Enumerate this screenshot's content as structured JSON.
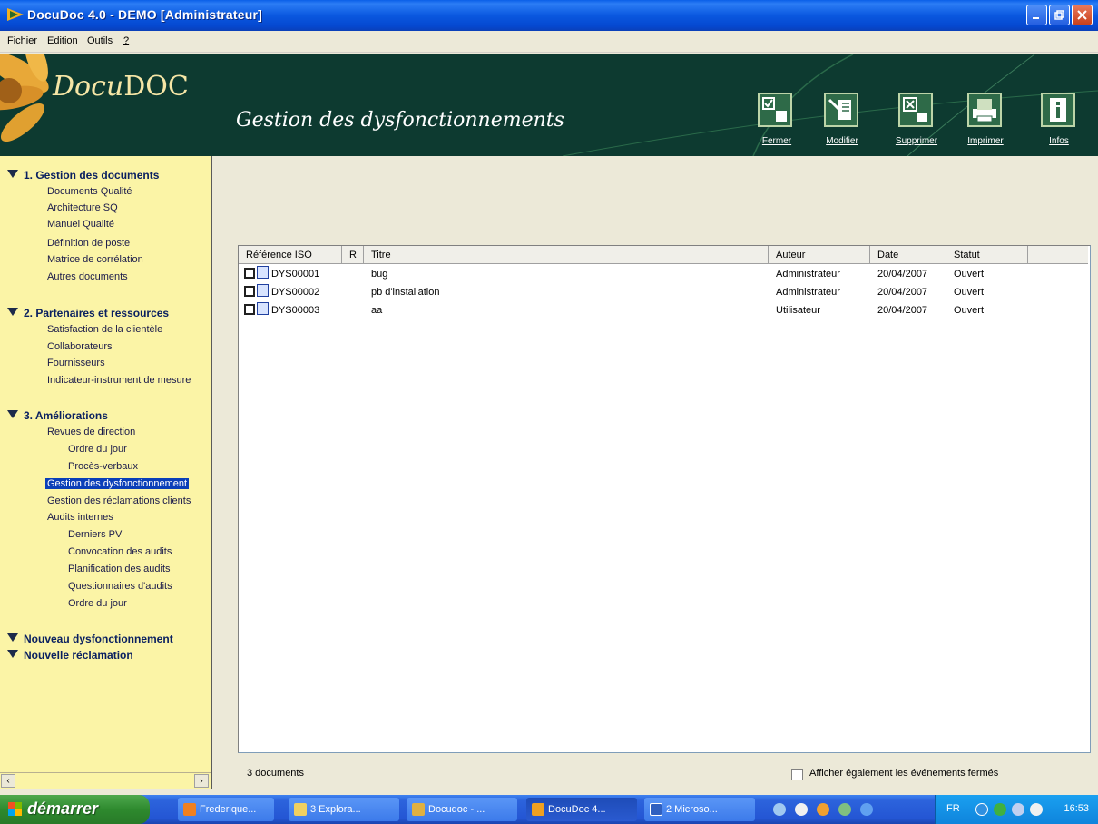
{
  "window": {
    "title": "DocuDoc 4.0 - DEMO [Administrateur]"
  },
  "menu": {
    "items": [
      "Fichier",
      "Edition",
      "Outils",
      "?"
    ]
  },
  "banner": {
    "logo_prefix": "Docu",
    "logo_suffix": "DOC",
    "heading": "Gestion des dysfonctionnements",
    "toolbar": [
      "Fermer",
      "Modifier",
      "Supprimer",
      "Imprimer",
      "Infos"
    ]
  },
  "sidebar": {
    "sections": [
      {
        "title": "1. Gestion des documents",
        "items": [
          "Documents Qualité",
          "Architecture SQ",
          "Manuel Qualité",
          "Définition de poste",
          "Matrice de corrélation",
          "Autres documents"
        ]
      },
      {
        "title": "2. Partenaires et ressources",
        "items": [
          "Satisfaction de la clientèle",
          "Collaborateurs",
          "Fournisseurs",
          "Indicateur-instrument de mesure"
        ]
      },
      {
        "title": "3. Améliorations",
        "items": [
          "Revues de direction",
          "Ordre du jour",
          "Procès-verbaux",
          "Gestion des dysfonctionnement",
          "Gestion des réclamations clients",
          "Audits internes",
          "Derniers PV",
          "Convocation des audits",
          "Planification des audits",
          "Questionnaires d'audits",
          "Ordre du jour"
        ]
      }
    ],
    "actions": [
      "Nouveau dysfonctionnement",
      "Nouvelle réclamation"
    ]
  },
  "table": {
    "columns": [
      "Référence ISO",
      "R",
      "Titre",
      "Auteur",
      "Date",
      "Statut"
    ],
    "rows": [
      {
        "ref": "DYS00001",
        "r": "",
        "titre": "bug",
        "auteur": "Administrateur",
        "date": "20/04/2007",
        "statut": "Ouvert"
      },
      {
        "ref": "DYS00002",
        "r": "",
        "titre": "pb d'installation",
        "auteur": "Administrateur",
        "date": "20/04/2007",
        "statut": "Ouvert"
      },
      {
        "ref": "DYS00003",
        "r": "",
        "titre": "aa",
        "auteur": "Utilisateur",
        "date": "20/04/2007",
        "statut": "Ouvert"
      }
    ]
  },
  "status": {
    "count": "3 documents",
    "show_closed_label": "Afficher également les événements fermés",
    "show_closed_checked": false
  },
  "taskbar": {
    "start": "démarrer",
    "tasks": [
      "Frederique...",
      "3 Explora...",
      "Docudoc - ...",
      "DocuDoc 4...",
      "2 Microso..."
    ],
    "lang": "FR",
    "clock": "16:53"
  }
}
